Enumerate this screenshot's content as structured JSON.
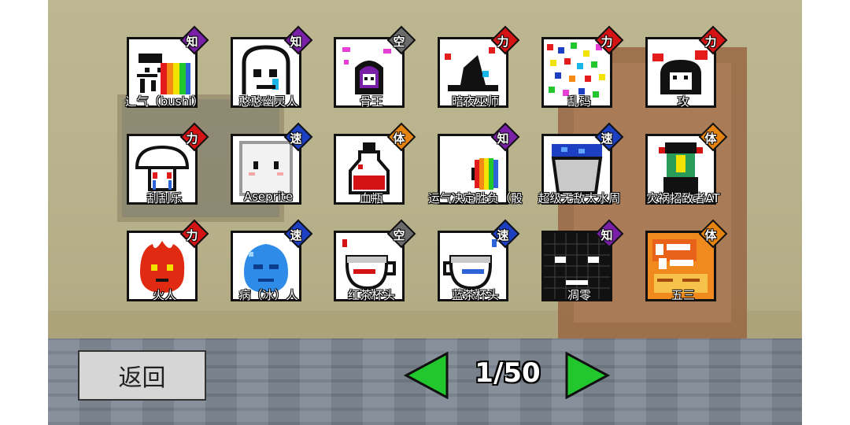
{
  "game": {
    "back_label": "返回",
    "page_indicator": "1/50",
    "colors": {
      "arrow_green": "#21c72c",
      "badge_知": "#7a1fa8",
      "badge_力": "#d41414",
      "badge_速": "#1d3fc2",
      "badge_体": "#e58410",
      "badge_空": "#6b6b6b"
    },
    "items": [
      {
        "name": "辶气（bushi）",
        "tag": "知",
        "icon": "rainbow-face-icon"
      },
      {
        "name": "憨憨幽灵人",
        "tag": "知",
        "icon": "ghost-icon"
      },
      {
        "name": "骨王",
        "tag": "空",
        "icon": "bone-king-icon"
      },
      {
        "name": "暗夜巫师",
        "tag": "力",
        "icon": "dark-wizard-icon"
      },
      {
        "name": "乱码",
        "tag": "力",
        "icon": "glitch-icon"
      },
      {
        "name": "攻",
        "tag": "力",
        "icon": "bow-face-icon"
      },
      {
        "name": "刮刮乐",
        "tag": "力",
        "icon": "crying-mushroom-icon"
      },
      {
        "name": "Aseprite",
        "tag": "速",
        "icon": "aseprite-icon"
      },
      {
        "name": "血瓶",
        "tag": "体",
        "icon": "blood-potion-icon"
      },
      {
        "name": "运气决定胜负（骰",
        "tag": "知",
        "icon": "rainbow-half-icon"
      },
      {
        "name": "超级无敌大水周",
        "tag": "速",
        "icon": "water-bucket-icon"
      },
      {
        "name": "灾祸招致者AT",
        "tag": "体",
        "icon": "jiangshi-icon"
      },
      {
        "name": "火人",
        "tag": "力",
        "icon": "fire-man-icon"
      },
      {
        "name": "病（冰）人",
        "tag": "速",
        "icon": "ice-man-icon"
      },
      {
        "name": "红茶杯头",
        "tag": "空",
        "icon": "red-teacup-icon"
      },
      {
        "name": "蓝茶杯头",
        "tag": "速",
        "icon": "blue-teacup-icon"
      },
      {
        "name": "凋零",
        "tag": "知",
        "icon": "wither-icon"
      },
      {
        "name": "五三",
        "tag": "体",
        "icon": "exam-book-icon"
      }
    ]
  }
}
